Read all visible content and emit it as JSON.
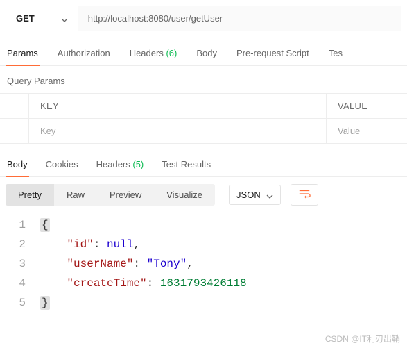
{
  "request": {
    "method": "GET",
    "url": "http://localhost:8080/user/getUser"
  },
  "request_tabs": {
    "params": "Params",
    "authorization": "Authorization",
    "headers_label": "Headers",
    "headers_count": "(6)",
    "body": "Body",
    "prerequest": "Pre-request Script",
    "tests": "Tes"
  },
  "query_params": {
    "title": "Query Params",
    "key_header": "KEY",
    "value_header": "VALUE",
    "key_placeholder": "Key",
    "value_placeholder": "Value"
  },
  "response_tabs": {
    "body": "Body",
    "cookies": "Cookies",
    "headers_label": "Headers",
    "headers_count": "(5)",
    "test_results": "Test Results"
  },
  "views": {
    "pretty": "Pretty",
    "raw": "Raw",
    "preview": "Preview",
    "visualize": "Visualize",
    "format": "JSON"
  },
  "response_body": {
    "id_key": "\"id\"",
    "id_val": "null",
    "userName_key": "\"userName\"",
    "userName_val": "\"Tony\"",
    "createTime_key": "\"createTime\"",
    "createTime_val": "1631793426118"
  },
  "watermark": "CSDN @IT利刃出鞘"
}
